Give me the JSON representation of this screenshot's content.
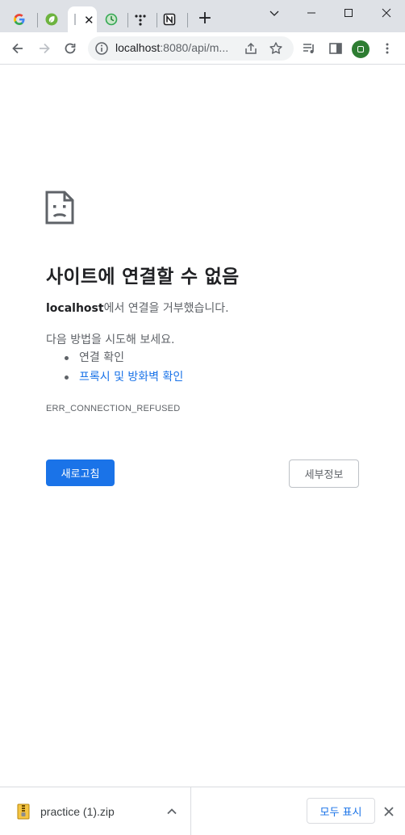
{
  "browser": {
    "tabs": [
      {
        "icon": "google-icon",
        "letter": "G"
      },
      {
        "icon": "spring-leaf-icon"
      },
      {
        "icon": "loading-icon",
        "active": true,
        "close_label": "✕"
      },
      {
        "icon": "green-clock-icon"
      },
      {
        "icon": "trello-dots-icon"
      },
      {
        "icon": "notion-icon",
        "letter": "N"
      }
    ],
    "new_tab_label": "+",
    "toolbar": {
      "url_host": "localhost",
      "url_rest": ":8080/api/m...",
      "avatar_color": "#2e7d32"
    }
  },
  "error_page": {
    "title": "사이트에 연결할 수 없음",
    "host": "localhost",
    "description_suffix": "에서 연결을 거부했습니다.",
    "suggestions_heading": "다음 방법을 시도해 보세요.",
    "suggestions": [
      {
        "label": "연결 확인",
        "is_link": false
      },
      {
        "label": "프록시 및 방화벽 확인",
        "is_link": true
      }
    ],
    "error_code": "ERR_CONNECTION_REFUSED",
    "reload_label": "새로고침",
    "details_label": "세부정보",
    "accent_color": "#1a73e8"
  },
  "download_shelf": {
    "file_name": "practice (1).zip",
    "show_all_label": "모두 표시",
    "file_icon": "zip-file-icon"
  }
}
